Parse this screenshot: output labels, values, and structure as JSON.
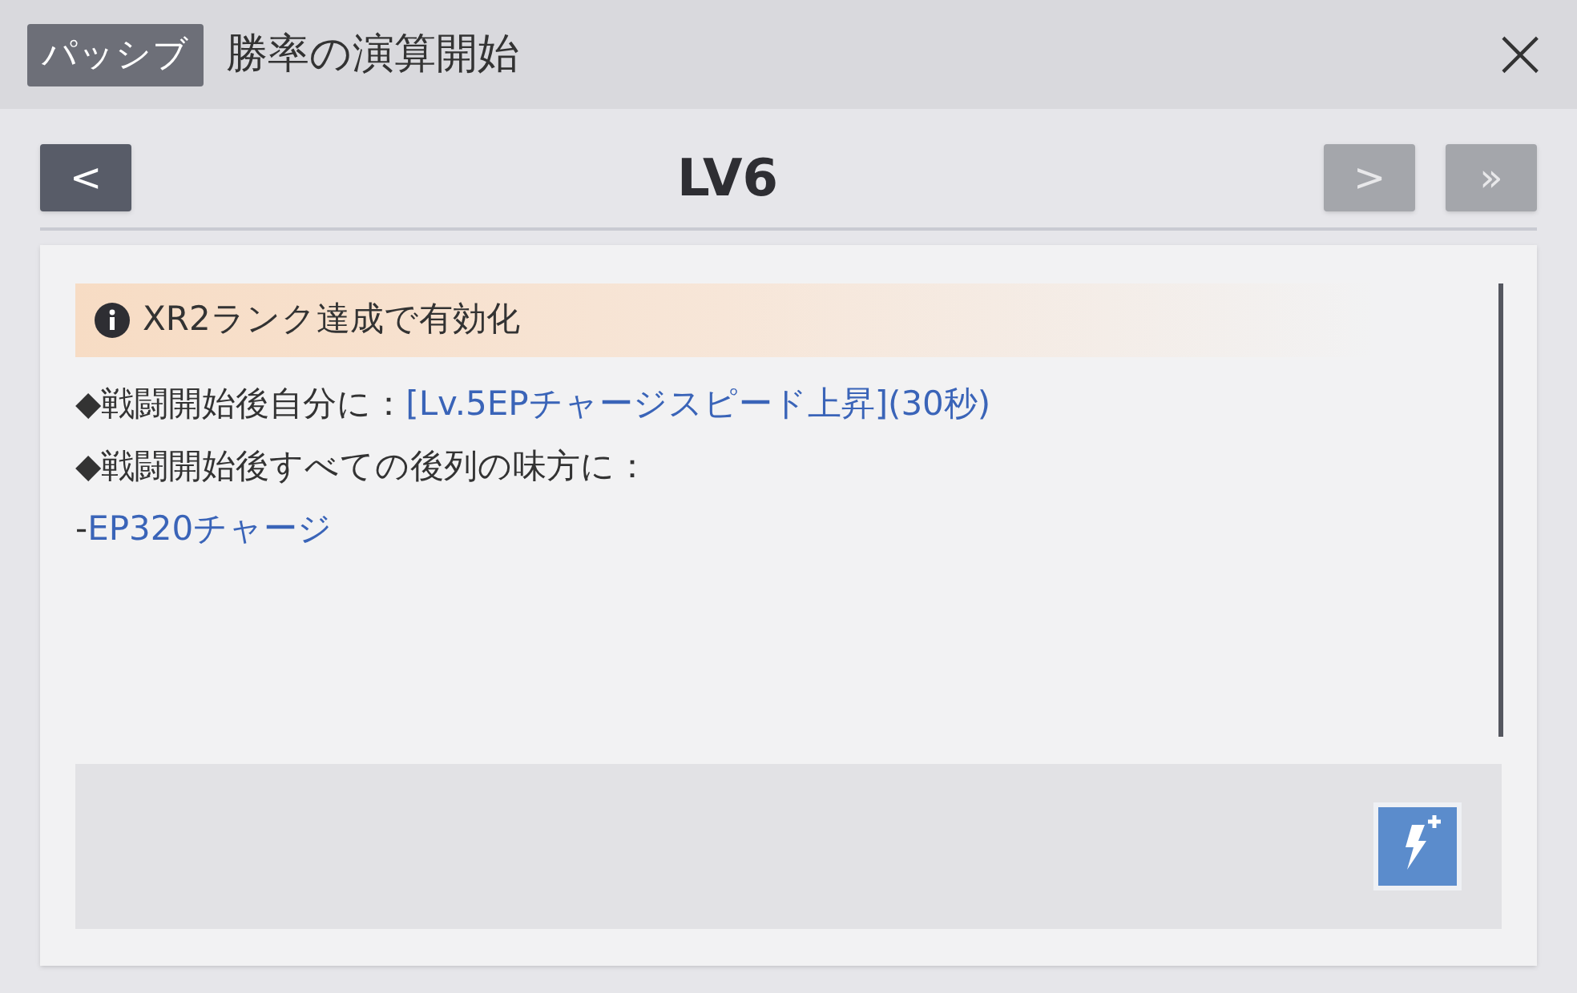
{
  "header": {
    "badge": "パッシブ",
    "title": "勝率の演算開始",
    "close": "×"
  },
  "nav": {
    "level": "LV6",
    "buttons": [
      {
        "kind": "prev",
        "label": "<",
        "disabled": false
      },
      {
        "kind": "next",
        "label": ">",
        "disabled": true
      },
      {
        "kind": "last",
        "label": "»",
        "disabled": true
      }
    ]
  },
  "notice": "XR2ランク達成で有効化",
  "lines": [
    [
      {
        "kind": "plain",
        "text": "◆戦闘開始後自分に："
      },
      {
        "kind": "link",
        "text": "[Lv.5EPチャージスピード上昇](30秒)"
      }
    ],
    [
      {
        "kind": "plain",
        "text": "◆戦闘開始後すべての後列の味方に："
      }
    ],
    [
      {
        "kind": "plain",
        "text": "-"
      },
      {
        "kind": "link",
        "text": "EP320チャージ"
      }
    ]
  ]
}
